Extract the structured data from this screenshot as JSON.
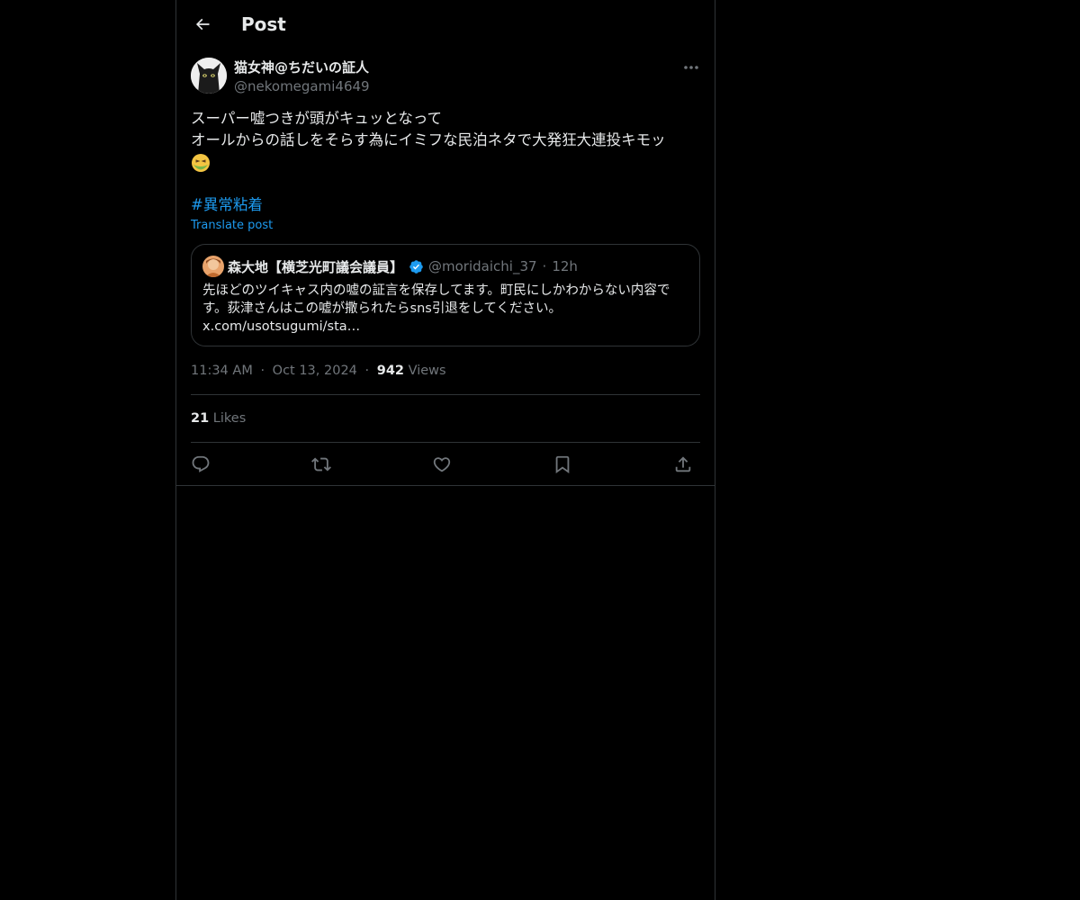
{
  "header": {
    "title": "Post",
    "back_icon": "arrow-left-icon"
  },
  "author": {
    "display_name": "猫女神@ちだいの証人",
    "handle": "@nekomegami4649"
  },
  "post": {
    "text_line1": "スーパー嘘つきが頭がキュッとなって",
    "text_line2": "オールからの話しをそらす為にイミフな民泊ネタで大発狂大連投キモッ",
    "emoji": "nauseated-face-icon",
    "hashtag": "#異常粘着",
    "translate_label": "Translate post"
  },
  "quote": {
    "display_name": "森大地【横芝光町議会議員】",
    "handle": "@moridaichi_37",
    "separator": "·",
    "time": "12h",
    "text": "先ほどのツイキャス内の嘘の証言を保存してます。町民にしかわからない内容です。荻津さんはこの嘘が撒られたらsns引退をしてください。 x.com/usotsugumi/sta…"
  },
  "meta": {
    "time": "11:34 AM",
    "dot": "·",
    "date": "Oct 13, 2024",
    "views_count": "942",
    "views_label": "Views"
  },
  "engagement": {
    "likes_count": "21",
    "likes_label": "Likes"
  },
  "actions": {
    "reply": "reply-icon",
    "repost": "repost-icon",
    "like": "heart-icon",
    "bookmark": "bookmark-icon",
    "share": "share-icon"
  },
  "colors": {
    "background": "#000000",
    "text": "#e7e9ea",
    "secondary": "#71767b",
    "accent": "#1d9bf0",
    "border": "#2f3336"
  }
}
